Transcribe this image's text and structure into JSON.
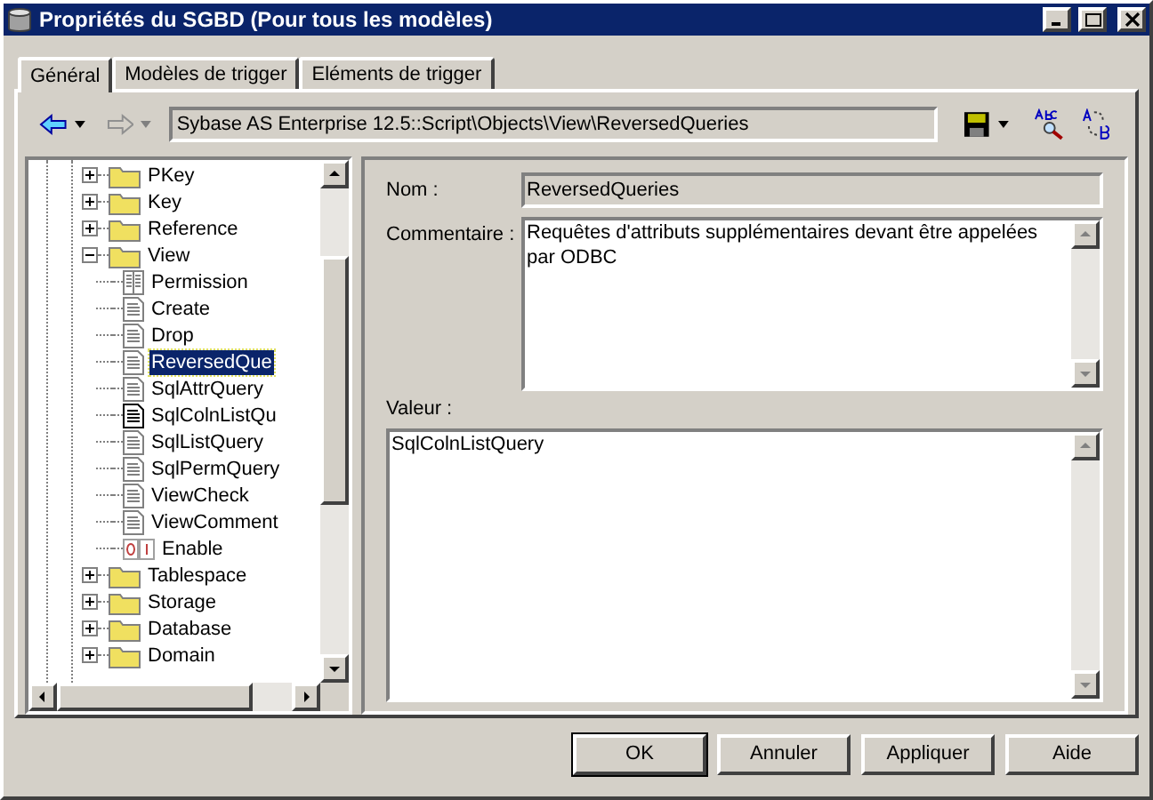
{
  "window": {
    "title": "Propriétés du SGBD (Pour tous les modèles)"
  },
  "tabs": [
    {
      "label": "Général",
      "selected": true
    },
    {
      "label": "Modèles de trigger",
      "selected": false
    },
    {
      "label": "Eléments de trigger",
      "selected": false
    }
  ],
  "toolbar": {
    "path": "Sybase AS Enterprise 12.5::Script\\Objects\\View\\ReversedQueries"
  },
  "tree": {
    "items": [
      {
        "label": "PKey",
        "kind": "folder",
        "expanded": false
      },
      {
        "label": "Key",
        "kind": "folder",
        "expanded": false
      },
      {
        "label": "Reference",
        "kind": "folder",
        "expanded": false
      },
      {
        "label": "View",
        "kind": "folder",
        "expanded": true,
        "children": [
          {
            "label": "Permission",
            "kind": "list",
            "selected": false
          },
          {
            "label": "Create",
            "kind": "script",
            "modified": false,
            "selected": false
          },
          {
            "label": "Drop",
            "kind": "script",
            "modified": false,
            "selected": false
          },
          {
            "label": "ReversedQue",
            "kind": "script",
            "modified": false,
            "selected": true
          },
          {
            "label": "SqlAttrQuery",
            "kind": "script",
            "modified": false,
            "selected": false
          },
          {
            "label": "SqlColnListQu",
            "kind": "script",
            "modified": true,
            "selected": false
          },
          {
            "label": "SqlListQuery",
            "kind": "script",
            "modified": false,
            "selected": false
          },
          {
            "label": "SqlPermQuery",
            "kind": "script",
            "modified": false,
            "selected": false
          },
          {
            "label": "ViewCheck",
            "kind": "script",
            "modified": false,
            "selected": false
          },
          {
            "label": "ViewComment",
            "kind": "script",
            "modified": false,
            "selected": false
          },
          {
            "label": "Enable",
            "kind": "boolean",
            "selected": false
          }
        ]
      },
      {
        "label": "Tablespace",
        "kind": "folder",
        "expanded": false
      },
      {
        "label": "Storage",
        "kind": "folder",
        "expanded": false
      },
      {
        "label": "Database",
        "kind": "folder",
        "expanded": false
      },
      {
        "label": "Domain",
        "kind": "folder",
        "expanded": false
      }
    ]
  },
  "fields": {
    "name": {
      "label": "Nom :",
      "value": "ReversedQueries"
    },
    "comment": {
      "label": "Commentaire :",
      "value": "Requêtes d'attributs supplémentaires devant être appelées par ODBC"
    },
    "value": {
      "label": "Valeur :",
      "value": "SqlColnListQuery"
    }
  },
  "buttons": [
    "OK",
    "Annuler",
    "Appliquer",
    "Aide"
  ]
}
